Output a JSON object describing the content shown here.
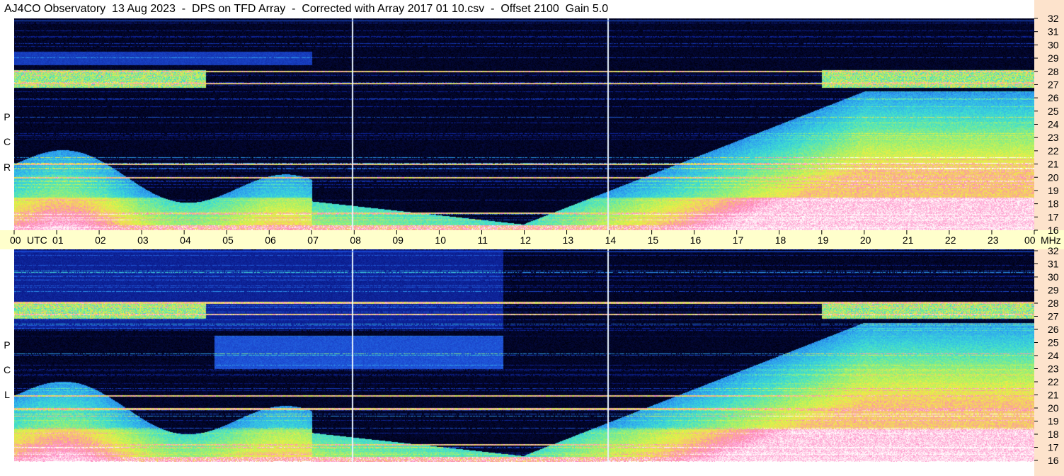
{
  "header": {
    "title": "AJ4CO Observatory  13 Aug 2023  -  DPS on TFD Array  -  Corrected with Array 2017 01 10.csv  -  Offset 2100  Gain 5.0"
  },
  "panels": {
    "top_label": [
      "R",
      "C",
      "P"
    ],
    "bottom_label": [
      "L",
      "C",
      "P"
    ]
  },
  "time_axis": {
    "unit_label": "UTC",
    "freq_unit": "MHz",
    "hour_labels": [
      "00",
      "01",
      "02",
      "03",
      "04",
      "05",
      "06",
      "07",
      "08",
      "09",
      "10",
      "11",
      "12",
      "13",
      "14",
      "15",
      "16",
      "17",
      "18",
      "19",
      "20",
      "21",
      "22",
      "23",
      "00"
    ]
  },
  "freq_axis": {
    "labels": [
      "16",
      "17",
      "18",
      "19",
      "20",
      "21",
      "22",
      "23",
      "24",
      "25",
      "26",
      "27",
      "28",
      "29",
      "30",
      "31",
      "32"
    ]
  },
  "colors": {
    "title_bg": "#ffffff",
    "time_bar_bg": "#ffffcc",
    "freq_axis_bg": "#fde3cc",
    "spectrogram_bg": "#000010",
    "colormap": [
      "#000010",
      "#0a1a8a",
      "#1e50d8",
      "#2fa8f0",
      "#3ee0d0",
      "#9cf070",
      "#f0f040",
      "#ff80c0",
      "#ffffff"
    ]
  },
  "chart_data": {
    "type": "heatmap",
    "title": "AJ4CO Observatory  13 Aug 2023  -  DPS on TFD Array  -  Corrected with Array 2017 01 10.csv  -  Offset 2100  Gain 5.0",
    "xlabel": "UTC",
    "ylabel": "MHz",
    "xlim": [
      0,
      24
    ],
    "ylim": [
      16,
      32
    ],
    "x_ticks_hours": [
      0,
      1,
      2,
      3,
      4,
      5,
      6,
      7,
      8,
      9,
      10,
      11,
      12,
      13,
      14,
      15,
      16,
      17,
      18,
      19,
      20,
      21,
      22,
      23,
      24
    ],
    "y_ticks_mhz": [
      16,
      17,
      18,
      19,
      20,
      21,
      22,
      23,
      24,
      25,
      26,
      27,
      28,
      29,
      30,
      31,
      32
    ],
    "panels": [
      "RCP",
      "LCP"
    ],
    "vertical_marker_hours": [
      7.95,
      13.95
    ],
    "strong_band_mhz": [
      27.1,
      28.0,
      21.0,
      20.0,
      17.3
    ],
    "quiet_interval_hours": [
      8.0,
      11.5
    ]
  }
}
